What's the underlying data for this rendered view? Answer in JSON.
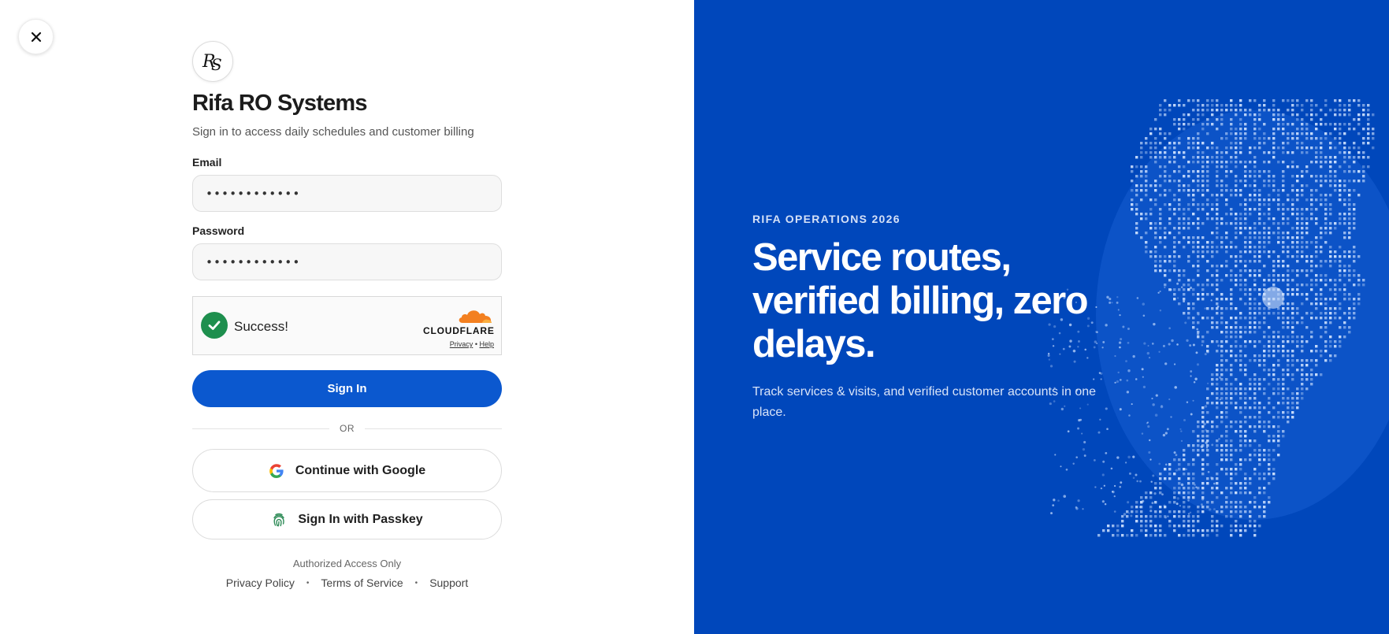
{
  "close_button": {
    "icon": "close-icon"
  },
  "brand": {
    "logo_text": "RS",
    "title": "Rifa RO Systems",
    "subtitle": "Sign in to access daily schedules and customer billing"
  },
  "form": {
    "email_label": "Email",
    "email_value": "••••••••••••",
    "password_label": "Password",
    "password_value": "••••••••••••",
    "captcha": {
      "status": "Success!",
      "provider": "CLOUDFLARE",
      "privacy": "Privacy",
      "separator": "•",
      "help": "Help"
    },
    "sign_in_label": "Sign In",
    "or_label": "OR",
    "google_label": "Continue with Google",
    "passkey_label": "Sign In with Passkey"
  },
  "footer": {
    "note": "Authorized Access Only",
    "links": [
      "Privacy Policy",
      "Terms of Service",
      "Support"
    ],
    "separator": "•"
  },
  "hero": {
    "eyebrow": "RIFA OPERATIONS 2026",
    "headline": "Service routes, verified billing, zero delays.",
    "description": "Track services & visits, and verified customer accounts in one place."
  },
  "colors": {
    "primary": "#0b58cf",
    "panel": "#0047bb",
    "success": "#1e8f4e",
    "cloudflare": "#f38020"
  }
}
